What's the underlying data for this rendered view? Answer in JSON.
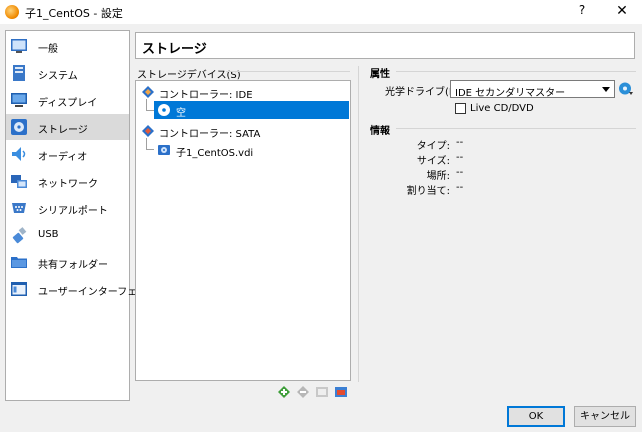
{
  "window": {
    "title": "子1_CentOS - 設定",
    "help_glyph": "?",
    "close_glyph": "✕"
  },
  "sidebar": {
    "items": [
      {
        "label": "一般",
        "icon": "general-icon"
      },
      {
        "label": "システム",
        "icon": "system-icon"
      },
      {
        "label": "ディスプレイ",
        "icon": "display-icon"
      },
      {
        "label": "ストレージ",
        "icon": "storage-icon",
        "selected": true
      },
      {
        "label": "オーディオ",
        "icon": "audio-icon"
      },
      {
        "label": "ネットワーク",
        "icon": "network-icon"
      },
      {
        "label": "シリアルポート",
        "icon": "serial-port-icon"
      },
      {
        "label": "USB",
        "icon": "usb-icon"
      },
      {
        "label": "共有フォルダー",
        "icon": "shared-folder-icon"
      },
      {
        "label": "ユーザーインターフェース",
        "icon": "user-interface-icon"
      }
    ]
  },
  "page": {
    "title": "ストレージ"
  },
  "storage_devices": {
    "label": "ストレージデバイス(S)",
    "tree": [
      {
        "label": "コントローラー: IDE",
        "type": "controller"
      },
      {
        "label": "空",
        "type": "optical",
        "selected": true
      },
      {
        "label": "コントローラー: SATA",
        "type": "controller"
      },
      {
        "label": "子1_CentOS.vdi",
        "type": "disk"
      }
    ]
  },
  "attributes": {
    "title": "属性",
    "drive_label": "光学ドライブ(D):",
    "drive_value": "IDE セカンダリマスター",
    "live_cd_label": "Live CD/DVD",
    "live_cd_checked": false
  },
  "info": {
    "title": "情報",
    "rows": [
      {
        "key": "タイプ:",
        "value": "--"
      },
      {
        "key": "サイズ:",
        "value": "--"
      },
      {
        "key": "場所:",
        "value": "--"
      },
      {
        "key": "割り当て:",
        "value": "--"
      }
    ]
  },
  "buttons": {
    "ok": "OK",
    "cancel": "キャンセル"
  },
  "colors": {
    "selection": "#0078d7",
    "sidebar_selection": "#dadada"
  }
}
